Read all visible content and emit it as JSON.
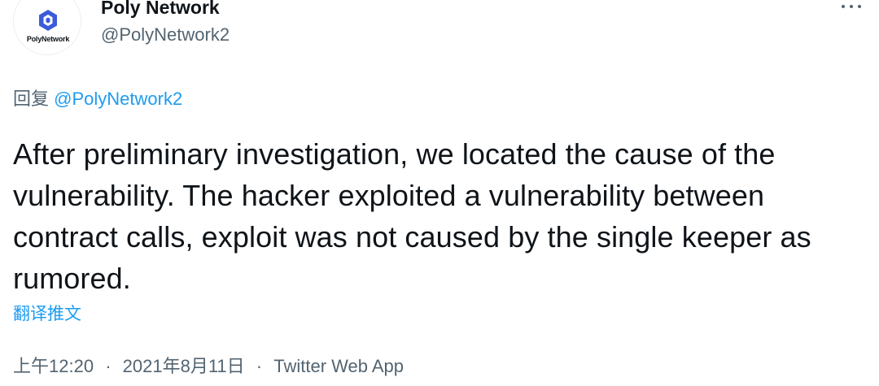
{
  "author": {
    "display_name": "Poly Network",
    "handle": "@PolyNetwork2",
    "avatar_label": "PolyNetwork",
    "avatar_icon": "poly-network-logo-icon",
    "more_icon": "more-options-icon"
  },
  "reply": {
    "prefix": "回复",
    "mention": "@PolyNetwork2"
  },
  "tweet": {
    "text": "After preliminary investigation, we located the cause of the vulnerability. The hacker exploited a vulnerability between contract calls, exploit was not caused by the single keeper as rumored."
  },
  "translate_label": "翻译推文",
  "meta": {
    "time": "上午12:20",
    "separator": "·",
    "date": "2021年8月11日",
    "source": "Twitter Web App"
  },
  "colors": {
    "text_primary": "#0f1419",
    "text_secondary": "#536471",
    "link_blue": "#1d9bf0",
    "logo_blue": "#3b5bdb"
  }
}
